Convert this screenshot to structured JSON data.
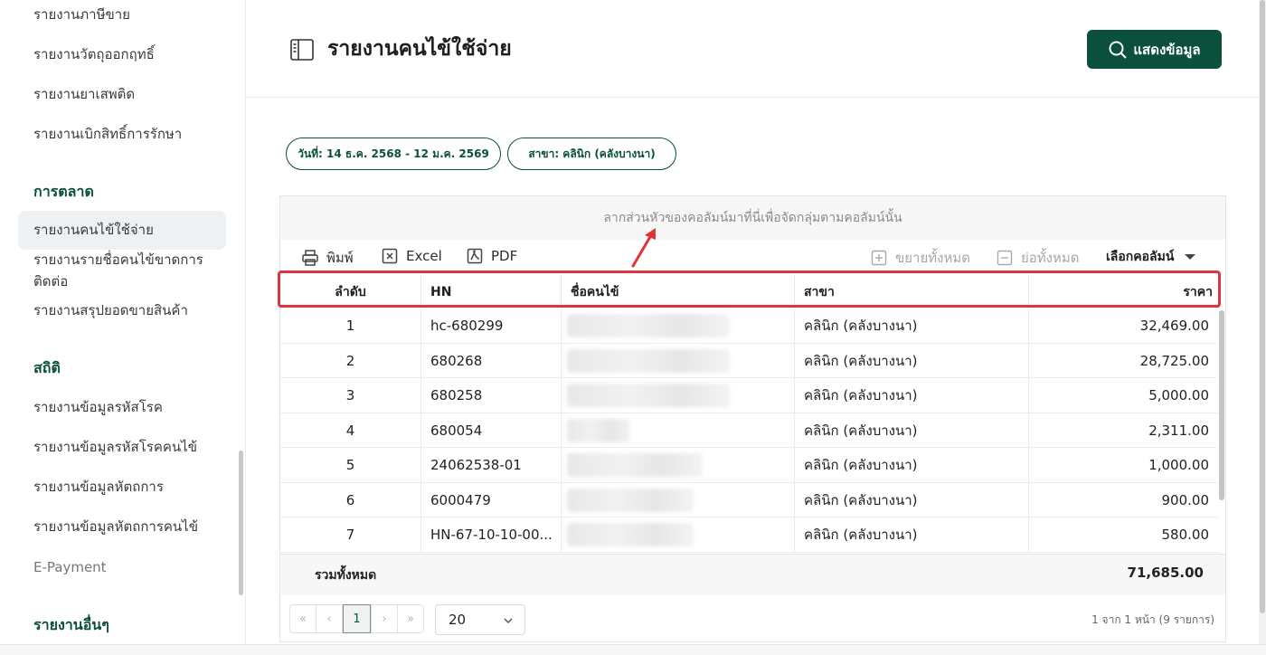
{
  "sidebar": {
    "items_top": [
      {
        "label": "รายงานภาษีขาย"
      },
      {
        "label": "รายงานวัตถุออกฤทธิ์"
      },
      {
        "label": "รายงานยาเสพติด"
      },
      {
        "label": "รายงานเบิกสิทธิ์การรักษา"
      }
    ],
    "group_marketing": "การตลาด",
    "items_marketing": [
      {
        "label": "รายงานคนไข้ใช้จ่าย"
      },
      {
        "label": "รายงานรายชื่อคนไข้ขาดการติดต่อ"
      },
      {
        "label": "รายงานสรุปยอดขายสินค้า"
      }
    ],
    "group_stats": "สถิติ",
    "items_stats": [
      {
        "label": "รายงานข้อมูลรหัสโรค"
      },
      {
        "label": "รายงานข้อมูลรหัสโรคคนไข้"
      },
      {
        "label": "รายงานข้อมูลหัตถการ"
      },
      {
        "label": "รายงานข้อมูลหัตถการคนไข้"
      },
      {
        "label": "E-Payment"
      }
    ],
    "group_other": "รายงานอื่นๆ"
  },
  "header": {
    "title": "รายงานคนไข้ใช้จ่าย",
    "show_button": "แสดงข้อมูล"
  },
  "filters": {
    "date": "วันที่: 14 ธ.ค. 2568 - 12 ม.ค. 2569",
    "branch": "สาขา: คลินิก (คลังบางนา)"
  },
  "grid": {
    "group_panel_text": "ลากส่วนหัวของคอลัมน์มาที่นี่เพื่อจัดกลุ่มตามคอลัมน์นั้น",
    "toolbar": {
      "print": "พิมพ์",
      "excel": "Excel",
      "pdf": "PDF",
      "expand_all": "ขยายทั้งหมด",
      "collapse_all": "ย่อทั้งหมด",
      "choose_columns": "เลือกคอลัมน์"
    },
    "columns": [
      "ลำดับ",
      "HN",
      "ชื่อคนไข้",
      "สาขา",
      "ราคา"
    ],
    "rows": [
      {
        "no": "1",
        "hn": "hc-680299",
        "branch": "คลินิก (คลังบางนา)",
        "price": "32,469.00"
      },
      {
        "no": "2",
        "hn": "680268",
        "branch": "คลินิก (คลังบางนา)",
        "price": "28,725.00"
      },
      {
        "no": "3",
        "hn": "680258",
        "branch": "คลินิก (คลังบางนา)",
        "price": "5,000.00"
      },
      {
        "no": "4",
        "hn": "680054",
        "branch": "คลินิก (คลังบางนา)",
        "price": "2,311.00"
      },
      {
        "no": "5",
        "hn": "24062538-01",
        "branch": "คลินิก (คลังบางนา)",
        "price": "1,000.00"
      },
      {
        "no": "6",
        "hn": "6000479",
        "branch": "คลินิก (คลังบางนา)",
        "price": "900.00"
      },
      {
        "no": "7",
        "hn": "HN-67-10-10-00...",
        "branch": "คลินิก (คลังบางนา)",
        "price": "580.00"
      }
    ],
    "summary_label": "รวมทั้งหมด",
    "summary_total": "71,685.00",
    "pager": {
      "first": "«",
      "prev": "‹",
      "current_page": "1",
      "next": "›",
      "last": "»",
      "page_size": "20",
      "info": "1 จาก 1 หน้า (9 รายการ)"
    }
  },
  "colors": {
    "brand": "#0b4f3d",
    "highlight": "#e0343a"
  }
}
